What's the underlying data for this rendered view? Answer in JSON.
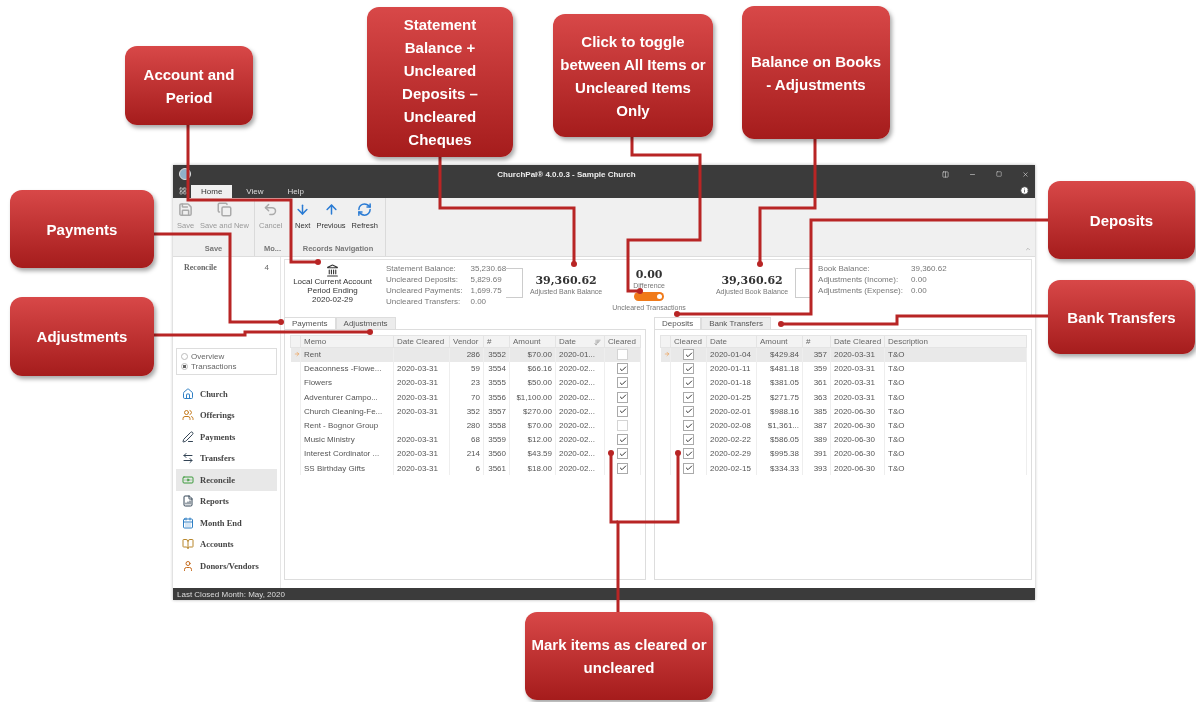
{
  "window": {
    "title": "ChurchPal® 4.0.0.3 - Sample Church",
    "menu_tabs": [
      {
        "label": "Home",
        "selected": true
      },
      {
        "label": "View",
        "selected": false
      },
      {
        "label": "Help",
        "selected": false
      }
    ]
  },
  "ribbon": {
    "groups": [
      {
        "label": "Save",
        "buttons": [
          {
            "label": "Save",
            "kind": "save",
            "disabled": true
          },
          {
            "label": "Save and New",
            "kind": "save-new",
            "disabled": true
          }
        ]
      },
      {
        "label": "Mo...",
        "buttons": [
          {
            "label": "Cancel",
            "kind": "cancel",
            "disabled": true
          }
        ]
      },
      {
        "label": "Records Navigation",
        "buttons": [
          {
            "label": "Next",
            "kind": "down",
            "disabled": false
          },
          {
            "label": "Previous",
            "kind": "up",
            "disabled": false
          },
          {
            "label": "Refresh",
            "kind": "refresh",
            "disabled": false
          }
        ]
      }
    ]
  },
  "sidebar": {
    "header": {
      "label": "Reconcile",
      "count": "4"
    },
    "view_options": [
      {
        "label": "Overview",
        "selected": false
      },
      {
        "label": "Transactions",
        "selected": true
      }
    ],
    "nav_items": [
      {
        "label": "Church",
        "kind": "church",
        "selected": false
      },
      {
        "label": "Offerings",
        "kind": "offerings",
        "selected": false
      },
      {
        "label": "Payments",
        "kind": "payments",
        "selected": false
      },
      {
        "label": "Transfers",
        "kind": "transfers",
        "selected": false
      },
      {
        "label": "Reconcile",
        "kind": "reconcile",
        "selected": true
      },
      {
        "label": "Reports",
        "kind": "reports",
        "selected": false
      },
      {
        "label": "Month End",
        "kind": "month-end",
        "selected": false
      },
      {
        "label": "Accounts",
        "kind": "accounts",
        "selected": false
      },
      {
        "label": "Donors/Vendors",
        "kind": "donors",
        "selected": false
      }
    ]
  },
  "summary": {
    "account": {
      "name": "Local Current Account",
      "period_label": "Period Ending",
      "period": "2020-02-29"
    },
    "bank_lines": [
      {
        "label": "Statement Balance:",
        "value": "35,230.68"
      },
      {
        "label": "Uncleared Deposits:",
        "value": "5,829.69"
      },
      {
        "label": "Uncleared Payments:",
        "value": "1,699.75"
      },
      {
        "label": "Uncleared Transfers:",
        "value": "0.00"
      }
    ],
    "adjusted_bank": {
      "value": "39,360.62",
      "label": "Adjusted Bank Balance"
    },
    "difference": {
      "value": "0.00",
      "label": "Difference"
    },
    "toggle": {
      "on": true,
      "label": "Uncleared Transactions"
    },
    "adjusted_book": {
      "value": "39,360.62",
      "label": "Adjusted Book Balance"
    },
    "book_lines": [
      {
        "label": "Book Balance:",
        "value": "39,360.62"
      },
      {
        "label": "Adjustments (Income):",
        "value": "0.00"
      },
      {
        "label": "Adjustments (Expense):",
        "value": "0.00"
      }
    ]
  },
  "payments_panel": {
    "tabs": [
      {
        "label": "Payments",
        "selected": true
      },
      {
        "label": "Adjustments",
        "selected": false
      }
    ],
    "columns": [
      {
        "label": "Memo",
        "sorted": false
      },
      {
        "label": "Date Cleared",
        "sorted": false
      },
      {
        "label": "Vendor",
        "sorted": false
      },
      {
        "label": "#",
        "sorted": false
      },
      {
        "label": "Amount",
        "sorted": false
      },
      {
        "label": "Date",
        "sorted": true
      },
      {
        "label": "Cleared",
        "sorted": false
      }
    ],
    "rows": [
      {
        "memo": "Rent",
        "vendor": "286",
        "number": "3552",
        "amount": "$70.00",
        "date": "2020-01...",
        "cleared": false,
        "current": true
      },
      {
        "memo": "Deaconness -Flowe...",
        "date_cleared": "2020-03-31",
        "vendor": "59",
        "number": "3554",
        "amount": "$66.16",
        "date": "2020-02...",
        "cleared": true,
        "current": false
      },
      {
        "memo": "Flowers",
        "date_cleared": "2020-03-31",
        "vendor": "23",
        "number": "3555",
        "amount": "$50.00",
        "date": "2020-02...",
        "cleared": true,
        "current": false
      },
      {
        "memo": "Adventurer Campo...",
        "date_cleared": "2020-03-31",
        "vendor": "70",
        "number": "3556",
        "amount": "$1,100.00",
        "date": "2020-02...",
        "cleared": true,
        "current": false
      },
      {
        "memo": "Church Cleaning-Fe...",
        "date_cleared": "2020-03-31",
        "vendor": "352",
        "number": "3557",
        "amount": "$270.00",
        "date": "2020-02...",
        "cleared": true,
        "current": false
      },
      {
        "memo": "Rent - Bognor Group",
        "vendor": "280",
        "number": "3558",
        "amount": "$70.00",
        "date": "2020-02...",
        "cleared": false,
        "current": false
      },
      {
        "memo": "Music Ministry",
        "date_cleared": "2020-03-31",
        "vendor": "68",
        "number": "3559",
        "amount": "$12.00",
        "date": "2020-02...",
        "cleared": true,
        "current": false
      },
      {
        "memo": "Interest Cordinator ...",
        "date_cleared": "2020-03-31",
        "vendor": "214",
        "number": "3560",
        "amount": "$43.59",
        "date": "2020-02...",
        "cleared": true,
        "current": false
      },
      {
        "memo": "SS Birthday Gifts",
        "date_cleared": "2020-03-31",
        "vendor": "6",
        "number": "3561",
        "amount": "$18.00",
        "date": "2020-02...",
        "cleared": true,
        "current": false
      }
    ]
  },
  "deposits_panel": {
    "tabs": [
      {
        "label": "Deposits",
        "selected": true
      },
      {
        "label": "Bank Transfers",
        "selected": false
      }
    ],
    "columns": [
      {
        "label": "Cleared"
      },
      {
        "label": "Date"
      },
      {
        "label": "Amount"
      },
      {
        "label": "#"
      },
      {
        "label": "Date Cleared"
      },
      {
        "label": "Description"
      }
    ],
    "rows": [
      {
        "cleared": true,
        "date": "2020-01-04",
        "amount": "$429.84",
        "number": "357",
        "date_cleared": "2020-03-31",
        "description": "T&O",
        "current": true
      },
      {
        "cleared": true,
        "date": "2020-01-11",
        "amount": "$481.18",
        "number": "359",
        "date_cleared": "2020-03-31",
        "description": "T&O",
        "current": false
      },
      {
        "cleared": true,
        "date": "2020-01-18",
        "amount": "$381.05",
        "number": "361",
        "date_cleared": "2020-03-31",
        "description": "T&O",
        "current": false
      },
      {
        "cleared": true,
        "date": "2020-01-25",
        "amount": "$271.75",
        "number": "363",
        "date_cleared": "2020-03-31",
        "description": "T&O",
        "current": false
      },
      {
        "cleared": true,
        "date": "2020-02-01",
        "amount": "$988.16",
        "number": "385",
        "date_cleared": "2020-06-30",
        "description": "T&O",
        "current": false
      },
      {
        "cleared": true,
        "date": "2020-02-08",
        "amount": "$1,361...",
        "number": "387",
        "date_cleared": "2020-06-30",
        "description": "T&O",
        "current": false
      },
      {
        "cleared": true,
        "date": "2020-02-22",
        "amount": "$586.05",
        "number": "389",
        "date_cleared": "2020-06-30",
        "description": "T&O",
        "current": false
      },
      {
        "cleared": true,
        "date": "2020-02-29",
        "amount": "$995.38",
        "number": "391",
        "date_cleared": "2020-06-30",
        "description": "T&O",
        "current": false
      },
      {
        "cleared": true,
        "date": "2020-02-15",
        "amount": "$334.33",
        "number": "393",
        "date_cleared": "2020-06-30",
        "description": "T&O",
        "current": false
      }
    ]
  },
  "status_bar": "Last Closed Month: May, 2020",
  "callouts": [
    {
      "text": "Account and Period"
    },
    {
      "text": "Statement Balance + Uncleared Deposits – Uncleared Cheques"
    },
    {
      "text": "Click to toggle between All Items or Uncleared Items Only"
    },
    {
      "text": "Balance on Books - Adjustments"
    },
    {
      "text": "Payments"
    },
    {
      "text": "Deposits"
    },
    {
      "text": "Adjustments"
    },
    {
      "text": "Bank Transfers"
    },
    {
      "text": "Mark items as cleared or uncleared"
    }
  ]
}
